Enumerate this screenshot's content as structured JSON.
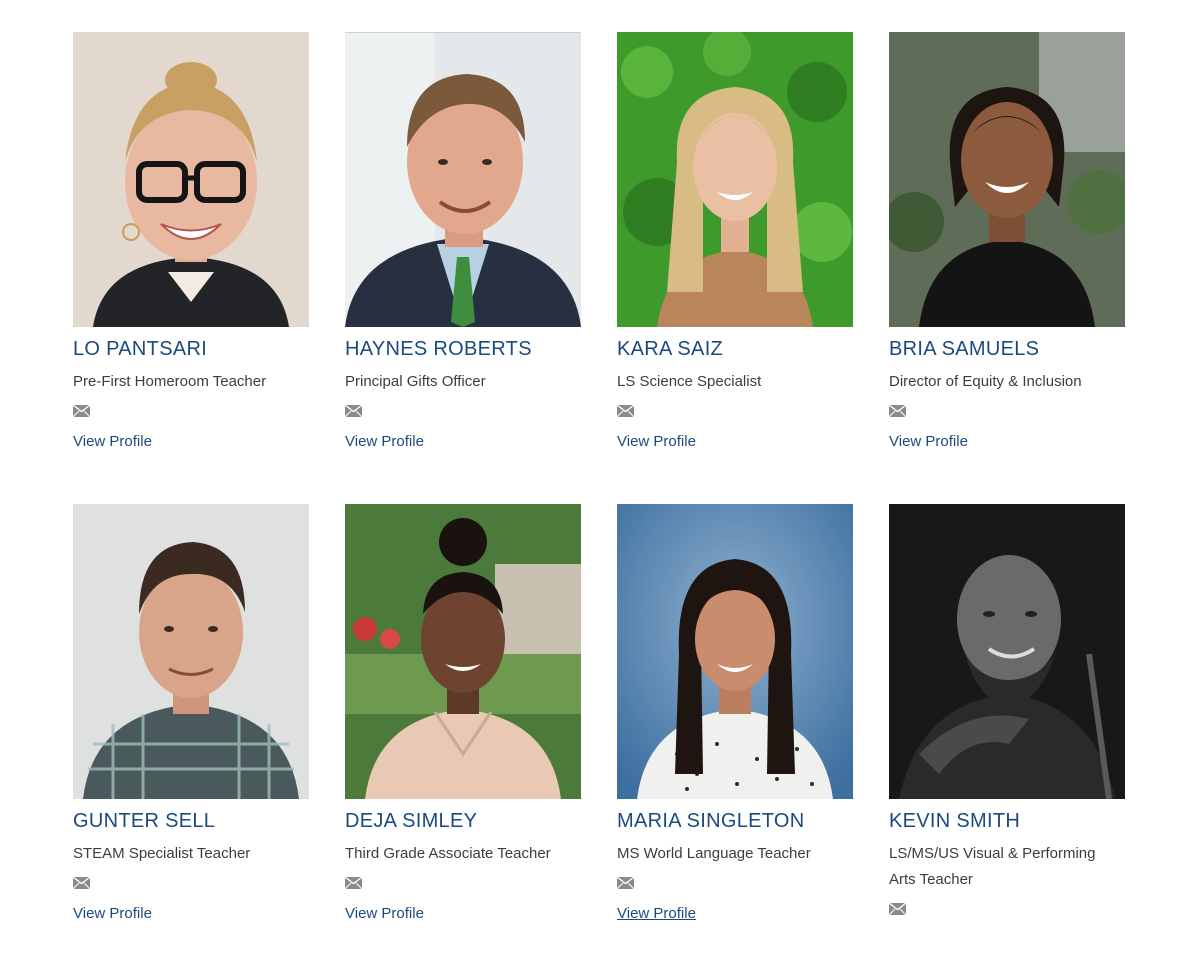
{
  "staff": [
    {
      "name": "LO PANTSARI",
      "title": "Pre-First Homeroom Teacher",
      "link": "View Profile",
      "photo_bg": "#dcd3c8",
      "shirt": "#222428",
      "skin": "#e8b9a0",
      "hair": "#c9a063",
      "glasses": true
    },
    {
      "name": "HAYNES ROBERTS",
      "title": "Principal Gifts Officer",
      "link": "View Profile",
      "photo_bg": "#e4e8ea",
      "shirt": "#263040",
      "skin": "#e2a88e",
      "hair": "#7a5a3a",
      "glasses": false
    },
    {
      "name": "KARA SAIZ",
      "title": "LS Science Specialist",
      "link": "View Profile",
      "photo_bg": "#3f9a2c",
      "shirt": "#b8865a",
      "skin": "#eac0a4",
      "hair": "#d9bb84",
      "glasses": false
    },
    {
      "name": "BRIA SAMUELS",
      "title": "Director of Equity & Inclusion",
      "link": "View Profile",
      "photo_bg": "#5f6d58",
      "shirt": "#141414",
      "skin": "#8c5a3c",
      "hair": "#1c1510",
      "glasses": false
    },
    {
      "name": "GUNTER SELL",
      "title": "STEAM Specialist Teacher",
      "link": "View Profile",
      "photo_bg": "#dfe0e0",
      "shirt": "#4a5a5c",
      "skin": "#d9a58a",
      "hair": "#3a2a20",
      "glasses": false
    },
    {
      "name": "DEJA SIMLEY",
      "title": "Third Grade Associate Teacher",
      "link": "View Profile",
      "photo_bg": "#4c7a3a",
      "shirt": "#e9c9b4",
      "skin": "#6e4330",
      "hair": "#1a120e",
      "glasses": false
    },
    {
      "name": "MARIA SINGLETON",
      "title": "MS World Language Teacher",
      "link": "View Profile",
      "link_underlined": true,
      "photo_bg": "#3d6fa0",
      "shirt": "#f0f0ee",
      "skin": "#c98c6c",
      "hair": "#1e1410",
      "glasses": false
    },
    {
      "name": "KEVIN SMITH",
      "title": "LS/MS/US Visual & Performing Arts Teacher",
      "link": "",
      "photo_bg": "#181818",
      "shirt": "#2a2a2a",
      "skin": "#6a6a6a",
      "hair": "#2a2a2a",
      "glasses": false
    }
  ],
  "colors": {
    "name": "#1b4a7e",
    "title": "#3d3d3d",
    "link": "#1b4a7e",
    "mail_icon": "#8a8a8a"
  }
}
